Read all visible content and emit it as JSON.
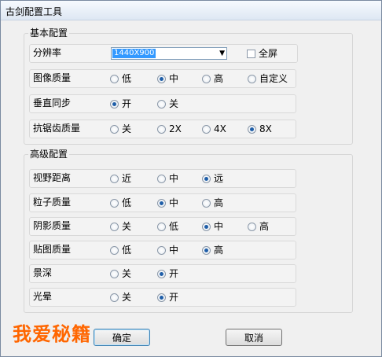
{
  "window": {
    "title": "古剑配置工具"
  },
  "basic": {
    "title": "基本配置",
    "resolution": {
      "label": "分辨率",
      "value": "1440X900",
      "fullscreen_label": "全屏"
    },
    "image_quality": {
      "label": "图像质量",
      "options": [
        "低",
        "中",
        "高",
        "自定义"
      ],
      "selected": "中"
    },
    "vsync": {
      "label": "垂直同步",
      "options": [
        "开",
        "关"
      ],
      "selected": "开"
    },
    "antialias": {
      "label": "抗锯齿质量",
      "options": [
        "关",
        "2X",
        "4X",
        "8X"
      ],
      "selected": "8X"
    }
  },
  "advanced": {
    "title": "高级配置",
    "view_distance": {
      "label": "视野距离",
      "options": [
        "近",
        "中",
        "远"
      ],
      "selected": "远"
    },
    "particles": {
      "label": "粒子质量",
      "options": [
        "低",
        "中",
        "高"
      ],
      "selected": "中"
    },
    "shadows": {
      "label": "阴影质量",
      "options": [
        "关",
        "低",
        "中",
        "高"
      ],
      "selected": "中"
    },
    "textures": {
      "label": "贴图质量",
      "options": [
        "低",
        "中",
        "高"
      ],
      "selected": "高"
    },
    "dof": {
      "label": "景深",
      "options": [
        "关",
        "开"
      ],
      "selected": "开"
    },
    "bloom": {
      "label": "光晕",
      "options": [
        "关",
        "开"
      ],
      "selected": "开"
    }
  },
  "buttons": {
    "ok": "确定",
    "cancel": "取消"
  },
  "watermark": "我爱秘籍",
  "colors": {
    "accent": "#1f5ea8",
    "watermark": "#ff6600",
    "selection": "#3399ff"
  }
}
